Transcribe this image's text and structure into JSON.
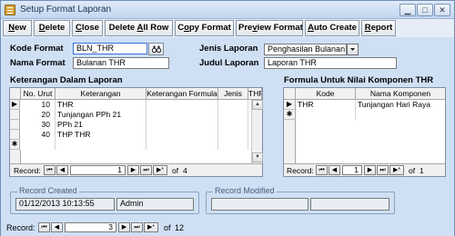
{
  "window": {
    "title": "Setup Format Laporan"
  },
  "toolbar": {
    "buttons": [
      {
        "pre": "",
        "ul": "N",
        "post": "ew"
      },
      {
        "pre": "",
        "ul": "D",
        "post": "elete"
      },
      {
        "pre": "",
        "ul": "C",
        "post": "lose"
      },
      {
        "pre": "Delete ",
        "ul": "A",
        "post": "ll Row"
      },
      {
        "pre": "C",
        "ul": "o",
        "post": "py Format"
      },
      {
        "pre": "Pre",
        "ul": "v",
        "post": "iew Format"
      },
      {
        "pre": "",
        "ul": "A",
        "post": "uto Create"
      },
      {
        "pre": "",
        "ul": "R",
        "post": "eport"
      }
    ]
  },
  "header": {
    "kode_label": "Kode Format",
    "kode_value": "BLN_THR",
    "nama_label": "Nama Format",
    "nama_value": "Bulanan THR",
    "jenis_label": "Jenis Laporan",
    "jenis_value": "Penghasilan Bulanan",
    "judul_label": "Judul Laporan",
    "judul_value": "Laporan THR"
  },
  "keterangan": {
    "title": "Keterangan Dalam Laporan",
    "columns": [
      "No. Urut",
      "Keterangan",
      "Keterangan Formula",
      "Jenis",
      "THP"
    ],
    "rows": [
      {
        "no": "10",
        "ket": "THR",
        "formula": "",
        "jenis": ""
      },
      {
        "no": "20",
        "ket": "Tunjangan PPh 21",
        "formula": "",
        "jenis": ""
      },
      {
        "no": "30",
        "ket": "PPh 21",
        "formula": "",
        "jenis": ""
      },
      {
        "no": "40",
        "ket": "THP THR",
        "formula": "",
        "jenis": ""
      }
    ],
    "nav": {
      "label": "Record:",
      "current": "1",
      "of_text": "of",
      "total": "4"
    }
  },
  "formula": {
    "title": "Formula Untuk Nilai Komponen THR",
    "columns": [
      "Kode",
      "Nama Komponen"
    ],
    "rows": [
      {
        "kode": "THR",
        "nama": "Tunjangan Hari Raya"
      }
    ],
    "nav": {
      "label": "Record:",
      "current": "1",
      "of_text": "of",
      "total": "1"
    }
  },
  "record_created": {
    "legend": "Record Created",
    "datetime": "01/12/2013 10:13:55",
    "user": "Admin"
  },
  "record_modified": {
    "legend": "Record Modified",
    "datetime": "",
    "user": ""
  },
  "main_nav": {
    "label": "Record:",
    "current": "3",
    "of_text": "of",
    "total": "12"
  },
  "icons": {
    "first": "⏮",
    "prev": "◀",
    "next": "▶",
    "last": "⏭",
    "new": "▶*",
    "current_row": "▶",
    "new_row": "✱"
  }
}
